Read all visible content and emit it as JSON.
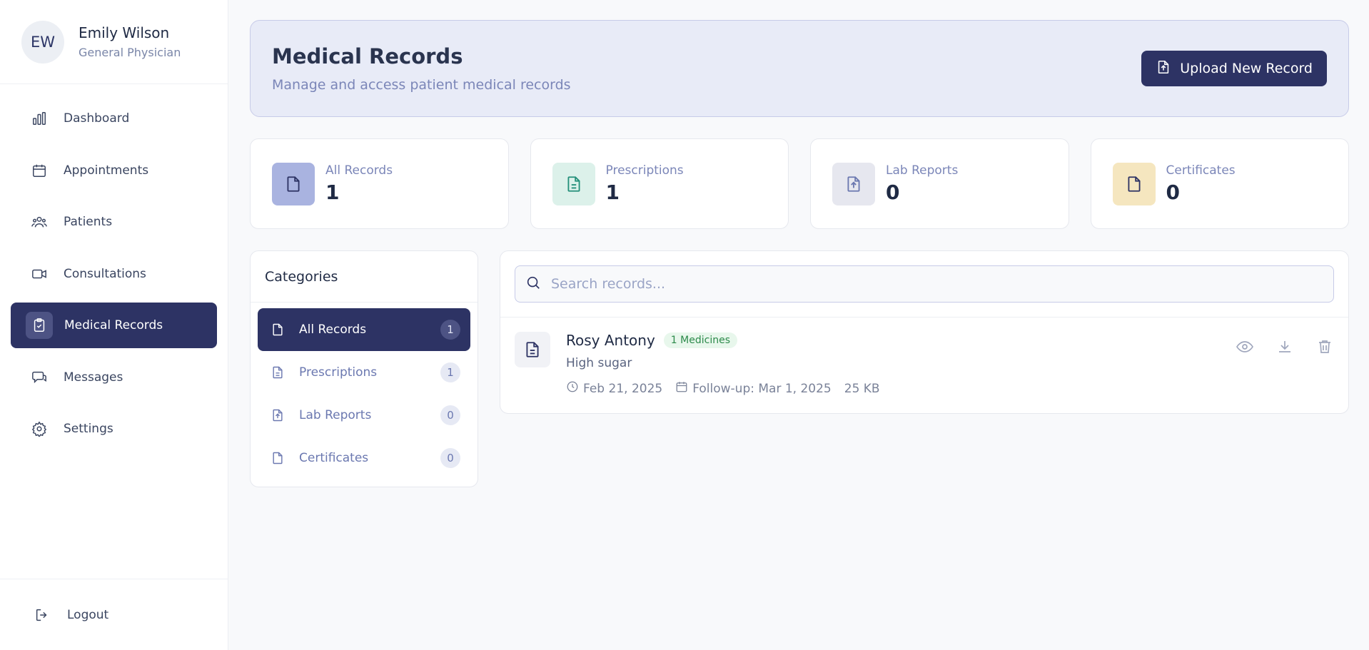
{
  "user": {
    "initials": "EW",
    "name": "Emily Wilson",
    "role": "General Physician"
  },
  "nav": {
    "items": [
      {
        "label": "Dashboard",
        "icon": "bar-chart-icon"
      },
      {
        "label": "Appointments",
        "icon": "calendar-icon"
      },
      {
        "label": "Patients",
        "icon": "users-icon"
      },
      {
        "label": "Consultations",
        "icon": "video-icon"
      },
      {
        "label": "Medical Records",
        "icon": "clipboard-icon",
        "active": true
      },
      {
        "label": "Messages",
        "icon": "chat-icon"
      },
      {
        "label": "Settings",
        "icon": "gear-icon"
      }
    ],
    "logout": "Logout"
  },
  "header": {
    "title": "Medical Records",
    "subtitle": "Manage and access patient medical records",
    "upload_label": "Upload New Record"
  },
  "stats": [
    {
      "label": "All Records",
      "value": "1",
      "icon": "file-icon",
      "bg": "#a9b3e0",
      "fg": "#2d3364"
    },
    {
      "label": "Prescriptions",
      "value": "1",
      "icon": "file-text-icon",
      "bg": "#dcf1ea",
      "fg": "#24907a"
    },
    {
      "label": "Lab Reports",
      "value": "0",
      "icon": "file-upload-icon",
      "bg": "#e6e7ef",
      "fg": "#6b78b0"
    },
    {
      "label": "Certificates",
      "value": "0",
      "icon": "file-icon",
      "bg": "#f5e6bf",
      "fg": "#2d3364"
    }
  ],
  "categories": {
    "title": "Categories",
    "items": [
      {
        "label": "All Records",
        "count": "1",
        "active": true
      },
      {
        "label": "Prescriptions",
        "count": "1"
      },
      {
        "label": "Lab Reports",
        "count": "0"
      },
      {
        "label": "Certificates",
        "count": "0"
      }
    ]
  },
  "search": {
    "placeholder": "Search records...",
    "value": ""
  },
  "records": [
    {
      "name": "Rosy Antony",
      "badge": "1 Medicines",
      "description": "High sugar",
      "date": "Feb 21, 2025",
      "followup": "Follow-up: Mar 1, 2025",
      "size": "25 KB"
    }
  ],
  "colors": {
    "primary": "#2d3364",
    "accent_bg": "#e8ebf7",
    "badge_green": "#2c8a4a"
  }
}
